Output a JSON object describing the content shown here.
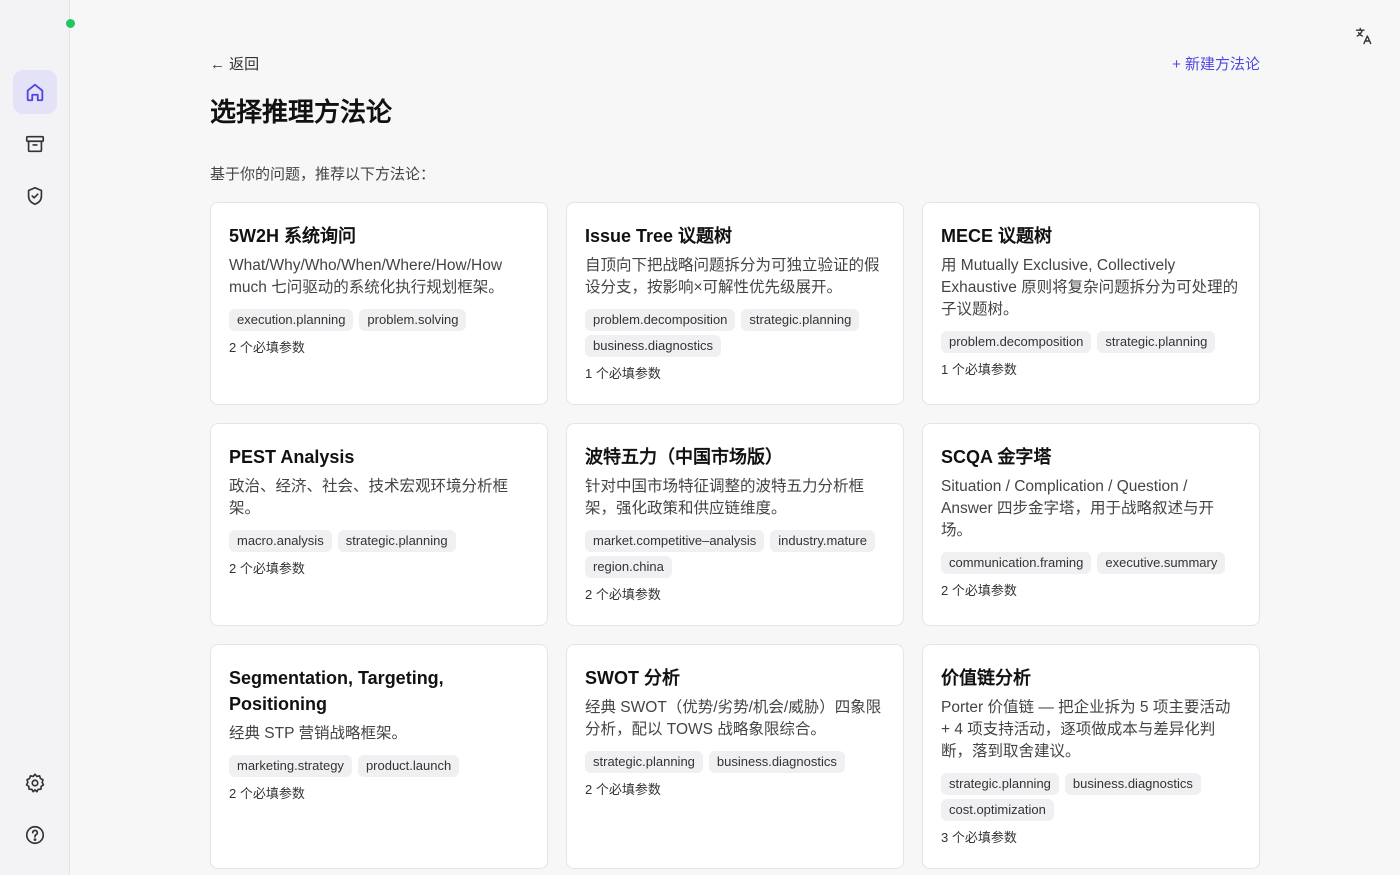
{
  "header": {
    "back_label": "← 返回",
    "new_label": "+ 新建方法论",
    "title": "选择推理方法论",
    "subtitle": "基于你的问题，推荐以下方法论："
  },
  "colors": {
    "accent": "#4f46e5",
    "active_nav_bg": "#e4e2f7",
    "status": "#22c55e"
  },
  "sidebar": {
    "items": [
      {
        "icon": "home-icon",
        "active": true
      },
      {
        "icon": "archive-icon",
        "active": false
      },
      {
        "icon": "shield-check-icon",
        "active": false
      },
      {
        "icon": "gear-icon",
        "active": false
      },
      {
        "icon": "help-icon",
        "active": false
      }
    ]
  },
  "cards": [
    {
      "title": "5W2H 系统询问",
      "desc": "What/Why/Who/When/Where/How/How much 七问驱动的系统化执行规划框架。",
      "tags": [
        "execution.planning",
        "problem.solving"
      ],
      "params": "2 个必填参数"
    },
    {
      "title": "Issue Tree 议题树",
      "desc": "自顶向下把战略问题拆分为可独立验证的假设分支，按影响×可解性优先级展开。",
      "tags": [
        "problem.decomposition",
        "strategic.planning",
        "business.diagnostics"
      ],
      "params": "1 个必填参数"
    },
    {
      "title": "MECE 议题树",
      "desc": "用 Mutually Exclusive, Collectively Exhaustive 原则将复杂问题拆分为可处理的子议题树。",
      "tags": [
        "problem.decomposition",
        "strategic.planning"
      ],
      "params": "1 个必填参数"
    },
    {
      "title": "PEST Analysis",
      "desc": "政治、经济、社会、技术宏观环境分析框架。",
      "tags": [
        "macro.analysis",
        "strategic.planning"
      ],
      "params": "2 个必填参数"
    },
    {
      "title": "波特五力（中国市场版）",
      "desc": "针对中国市场特征调整的波特五力分析框架，强化政策和供应链维度。",
      "tags": [
        "market.competitive–analysis",
        "industry.mature",
        "region.china"
      ],
      "params": "2 个必填参数"
    },
    {
      "title": "SCQA 金字塔",
      "desc": "Situation / Complication / Question / Answer 四步金字塔，用于战略叙述与开场。",
      "tags": [
        "communication.framing",
        "executive.summary"
      ],
      "params": "2 个必填参数"
    },
    {
      "title": "Segmentation, Targeting, Positioning",
      "desc": "经典 STP 营销战略框架。",
      "tags": [
        "marketing.strategy",
        "product.launch"
      ],
      "params": "2 个必填参数"
    },
    {
      "title": "SWOT 分析",
      "desc": "经典 SWOT（优势/劣势/机会/威胁）四象限分析，配以 TOWS 战略象限综合。",
      "tags": [
        "strategic.planning",
        "business.diagnostics"
      ],
      "params": "2 个必填参数"
    },
    {
      "title": "价值链分析",
      "desc": "Porter 价值链 — 把企业拆为 5 项主要活动 + 4 项支持活动，逐项做成本与差异化判断，落到取舍建议。",
      "tags": [
        "strategic.planning",
        "business.diagnostics",
        "cost.optimization"
      ],
      "params": "3 个必填参数"
    }
  ]
}
